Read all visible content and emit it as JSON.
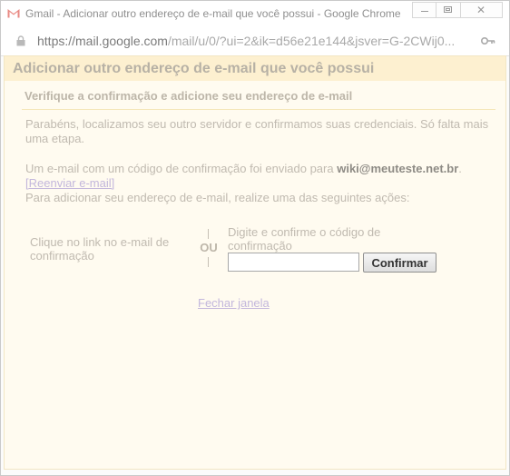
{
  "window": {
    "title": "Gmail - Adicionar outro endereço de e-mail que você possui - Google Chrome",
    "controls": {
      "minimize": "minimize",
      "maximize": "maximize",
      "close": "✕"
    }
  },
  "addressbar": {
    "url_host": "https://mail.google.com",
    "url_rest": "/mail/u/0/?ui=2&ik=d56e21e144&jsver=G-2CWij0..."
  },
  "dialog": {
    "title": "Adicionar outro endereço de e-mail que você possui",
    "subtitle": "Verifique a confirmação e adicione seu endereço de e-mail",
    "success_text": "Parabéns, localizamos seu outro servidor e confirmamos suas credenciais. Só falta mais uma etapa.",
    "sent_text_before": "Um e-mail com um código de confirmação foi enviado para ",
    "email": "wiki@meuteste.net.br",
    "sent_text_after": ".",
    "resend_link": "[Reenviar e-mail]",
    "actions_text": "Para adicionar seu endereço de e-mail, realize uma das seguintes ações:",
    "option_link": "Clique no link no e-mail de confirmação",
    "or_label": "OU",
    "option_code": "Digite e confirme o código de confirmação",
    "code_value": "",
    "confirm_button": "Confirmar",
    "close_link": "Fechar janela"
  },
  "colors": {
    "dialog_background": "#fffbf0",
    "header_background": "#fdf0d0",
    "link": "#c3b7dc"
  }
}
